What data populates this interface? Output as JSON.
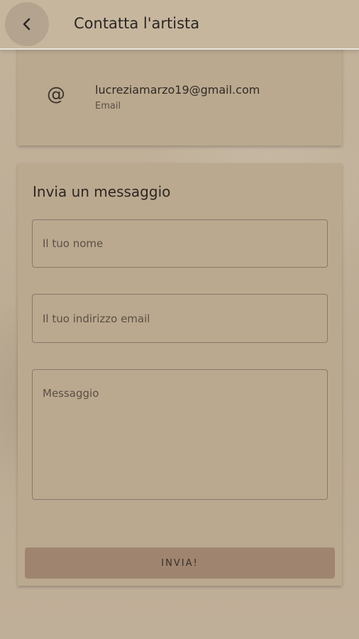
{
  "header": {
    "title": "Contatta l'artista",
    "back_icon": "chevron-left-icon"
  },
  "contact": {
    "icon": "@",
    "value": "lucreziamarzo19@gmail.com",
    "type": "Email"
  },
  "form": {
    "title": "Invia un messaggio",
    "name_placeholder": "Il tuo nome",
    "email_placeholder": "Il tuo indirizzo email",
    "message_placeholder": "Messaggio",
    "submit_label": "INVIA!"
  },
  "colors": {
    "background": "#c1b19b",
    "card": "#bba98f",
    "button": "#9f8570",
    "appbar": "#c7b69e"
  }
}
